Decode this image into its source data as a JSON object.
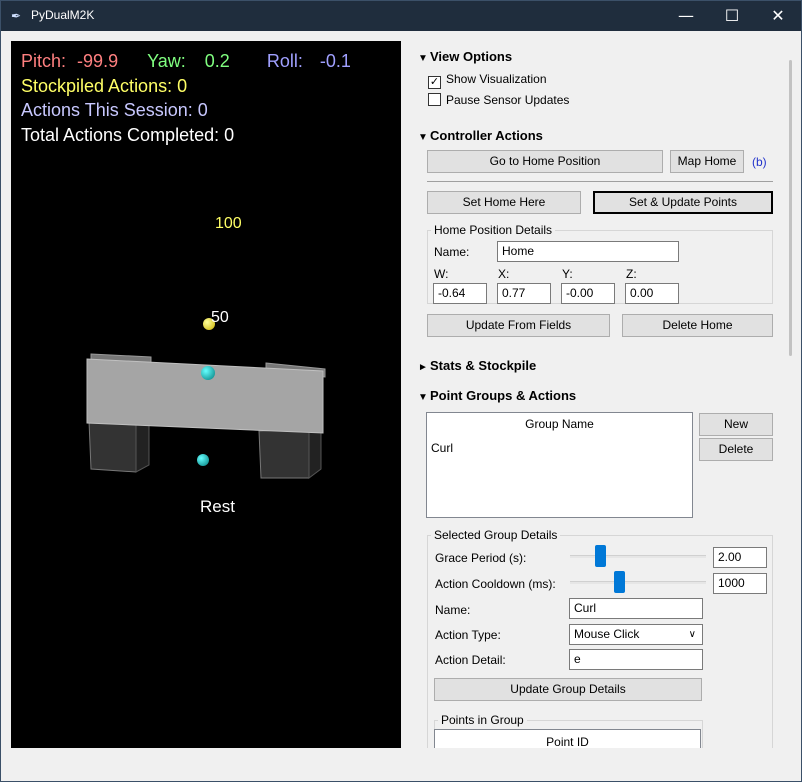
{
  "window": {
    "title": "PyDualM2K",
    "minimize": "—",
    "maximize": "☐",
    "close": "✕"
  },
  "hud": {
    "pitch_label": "Pitch:",
    "pitch_value": "-99.9",
    "yaw_label": "Yaw:",
    "yaw_value": "0.2",
    "roll_label": "Roll:",
    "roll_value": "-0.1",
    "stockpiled": "Stockpiled Actions: 0",
    "session": "Actions This Session: 0",
    "total": "Total Actions Completed: 0",
    "colors": {
      "pitch": "#ff8080",
      "yaw": "#80ff80",
      "roll": "#a0a0ff",
      "stockpiled": "#ffff66",
      "session": "#c8c8ff",
      "total": "#ffffff"
    }
  },
  "viz": {
    "label_100": "100",
    "label_50": "50",
    "label_rest": "Rest"
  },
  "view_options": {
    "header": "View Options",
    "show_visualization": {
      "label": "Show Visualization",
      "checked": true
    },
    "pause_sensor": {
      "label": "Pause Sensor Updates",
      "checked": false
    }
  },
  "controller_actions": {
    "header": "Controller Actions",
    "go_home": "Go to Home Position",
    "map_home": "Map Home",
    "map_home_key": "(b)",
    "set_home": "Set Home Here",
    "set_update_points": "Set & Update Points",
    "home_details": {
      "title": "Home Position Details",
      "name_label": "Name:",
      "name_value": "Home",
      "w_label": "W:",
      "w_value": "-0.64",
      "x_label": "X:",
      "x_value": "0.77",
      "y_label": "Y:",
      "y_value": "-0.00",
      "z_label": "Z:",
      "z_value": "0.00"
    },
    "update_from_fields": "Update From Fields",
    "delete_home": "Delete Home"
  },
  "stats": {
    "header": "Stats & Stockpile"
  },
  "point_groups": {
    "header": "Point Groups & Actions",
    "column_header": "Group Name",
    "items": [
      "Curl"
    ],
    "new_button": "New",
    "delete_button": "Delete",
    "selected": {
      "title": "Selected Group Details",
      "grace_label": "Grace Period (s):",
      "grace_value": "2.00",
      "grace_fraction": 0.2,
      "cooldown_label": "Action Cooldown (ms):",
      "cooldown_value": "1000",
      "cooldown_fraction": 0.35,
      "name_label": "Name:",
      "name_value": "Curl",
      "action_type_label": "Action Type:",
      "action_type_value": "Mouse Click",
      "action_detail_label": "Action Detail:",
      "action_detail_value": "e",
      "update_button": "Update Group Details"
    },
    "points": {
      "title": "Points in Group",
      "column_header": "Point ID"
    }
  },
  "icons": {
    "collapse": "▼",
    "expand": "►",
    "check": "✓",
    "dropdown": "chevron-down-icon"
  }
}
